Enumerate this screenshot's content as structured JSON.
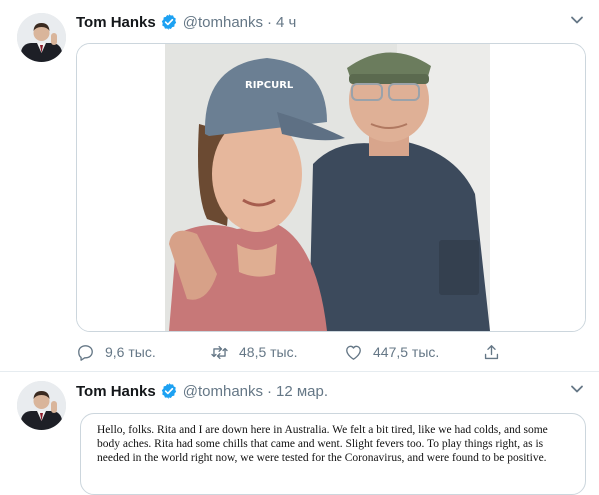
{
  "tweets": [
    {
      "name": "Tom Hanks",
      "handle": "@tomhanks",
      "separator": "·",
      "time": "4 ч",
      "replies": "9,6 тыс.",
      "retweets": "48,5 тыс.",
      "likes": "447,5 тыс."
    },
    {
      "name": "Tom Hanks",
      "handle": "@tomhanks",
      "separator": "·",
      "time": "12 мар.",
      "statement": "Hello, folks. Rita and I are down here in Australia. We felt a bit tired, like we had colds, and some body aches. Rita had some chills that came and went. Slight fevers too. To play things right, as is needed in the world right now, we were tested for the Coronavirus, and were found to be positive."
    }
  ],
  "photo": {
    "cap_text": "RIPCURL"
  },
  "colors": {
    "verified": "#1da1f2",
    "meta_gray": "#657786",
    "border": "#ccd6dd"
  },
  "icons": [
    "verified-badge-icon",
    "chevron-down-icon",
    "reply-icon",
    "retweet-icon",
    "like-icon",
    "share-icon"
  ]
}
